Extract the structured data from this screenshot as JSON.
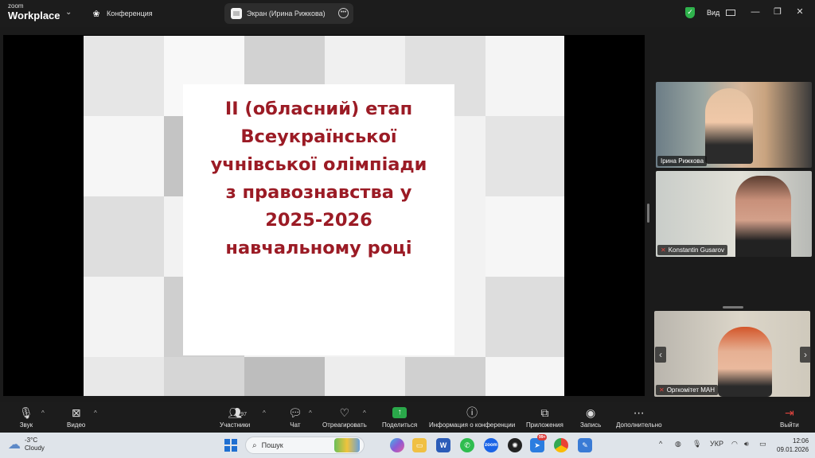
{
  "titlebar": {
    "brand_small": "zoom",
    "brand_large": "Workplace",
    "tab_conference": "Конференция",
    "tab_screen": "Экран (Ирина Рижкова)",
    "view_label": "Вид"
  },
  "slide": {
    "title": "II (обласний) етап\nВсеукраїнської\nучнівської олімпіади\nз правознавства у\n2025-2026\nнавчальному році",
    "title_color": "#9b1b25"
  },
  "participants_videos": [
    {
      "name": "Ірина Рижкова",
      "muted": false
    },
    {
      "name": "Konstantin Gusarov",
      "muted": true
    },
    {
      "name": "Оргкомітет МАН",
      "muted": true
    }
  ],
  "toolbar": {
    "audio": "Звук",
    "video": "Видео",
    "participants": "Участники",
    "participants_count": "97",
    "chat": "Чат",
    "react": "Отреагировать",
    "share": "Поделиться",
    "info": "Информация о конференции",
    "apps": "Приложения",
    "record": "Запись",
    "more": "Дополнительно",
    "leave": "Выйти"
  },
  "taskbar": {
    "temp": "-3°C",
    "weather": "Cloudy",
    "search_placeholder": "Пошук",
    "lang": "УКР",
    "time": "12:06",
    "date": "09.01.2026",
    "badge_count": "99+"
  },
  "colors": {
    "accent_green": "#2aa84a",
    "mute_red": "#e0443e",
    "slide_title": "#9b1b25"
  }
}
